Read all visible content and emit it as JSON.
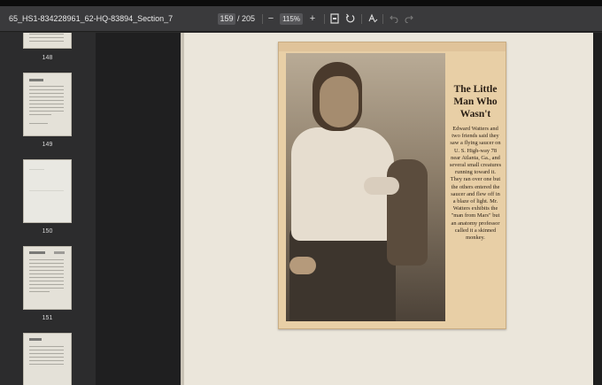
{
  "window": {
    "title": "65_HS1-834228961_62-HQ-83894_Section_7"
  },
  "toolbar": {
    "current_page": "159",
    "total_pages": "/ 205",
    "zoom_out_label": "−",
    "zoom_level": "115%",
    "zoom_in_label": "+",
    "icons": [
      "page-fit-icon",
      "rotate-icon",
      "text-format-icon",
      "undo-icon",
      "redo-icon"
    ]
  },
  "sidebar": {
    "thumbnails": [
      {
        "label": "148"
      },
      {
        "label": "149"
      },
      {
        "label": "150"
      },
      {
        "label": "151"
      },
      {
        "label": ""
      }
    ]
  },
  "document": {
    "clipping": {
      "headline": "The Little Man Who Wasn't",
      "body": "Edward Watters and two friends said they saw a flying saucer on U. S. High-way 78 near Atlanta, Ga., and several small creatures running toward it. They ran over one but the others entered the saucer and flew off in a blaze of light. Mr. Watters exhibits the \"man from Mars\" but an anatomy professor called it a skinned monkey."
    }
  },
  "colors": {
    "toolbar_bg": "#3a3a3c",
    "sidebar_bg": "#2c2c2d",
    "page_bg": "#ebe6db",
    "clipping_bg": "#e8cfa6"
  }
}
